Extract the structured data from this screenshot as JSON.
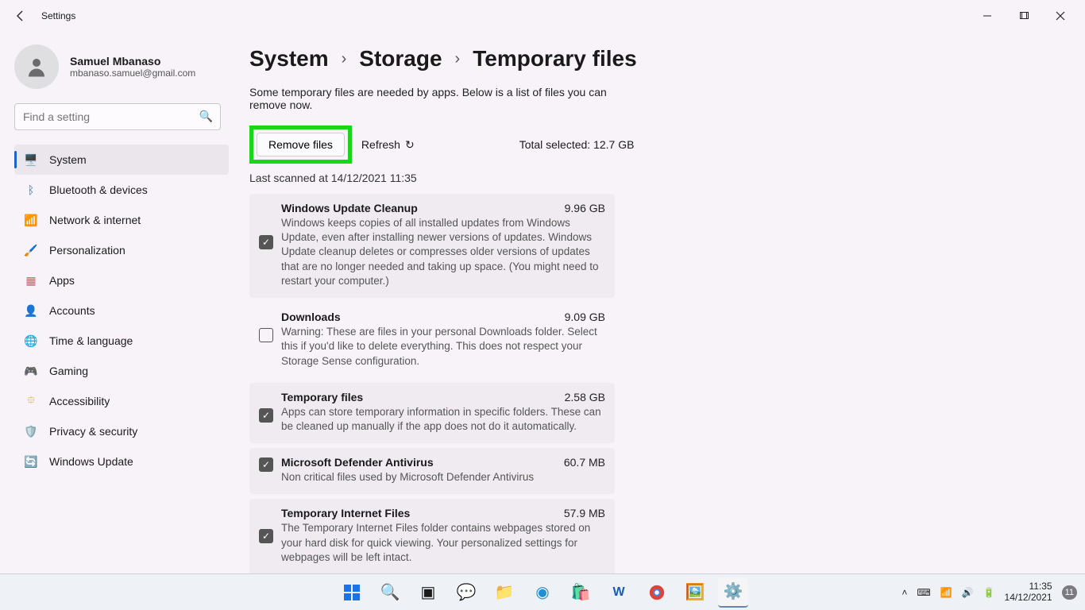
{
  "app": {
    "title": "Settings"
  },
  "user": {
    "name": "Samuel Mbanaso",
    "email": "mbanaso.samuel@gmail.com"
  },
  "search": {
    "placeholder": "Find a setting"
  },
  "nav": [
    {
      "label": "System",
      "icon": "🖥️",
      "active": true
    },
    {
      "label": "Bluetooth & devices",
      "icon": "ᛒ",
      "color": "#1a73e8"
    },
    {
      "label": "Network & internet",
      "icon": "📶",
      "color": "#1a9ae8"
    },
    {
      "label": "Personalization",
      "icon": "🖌️"
    },
    {
      "label": "Apps",
      "icon": "▦",
      "color": "#d85a5a"
    },
    {
      "label": "Accounts",
      "icon": "👤",
      "color": "#2bbf55"
    },
    {
      "label": "Time & language",
      "icon": "🌐",
      "color": "#3b7dd8"
    },
    {
      "label": "Gaming",
      "icon": "🎮",
      "color": "#777"
    },
    {
      "label": "Accessibility",
      "icon": "⯐",
      "color": "#d8a32b"
    },
    {
      "label": "Privacy & security",
      "icon": "🛡️",
      "color": "#777"
    },
    {
      "label": "Windows Update",
      "icon": "🔄",
      "color": "#1a73e8"
    }
  ],
  "breadcrumb": {
    "a": "System",
    "b": "Storage",
    "c": "Temporary files"
  },
  "page": {
    "description": "Some temporary files are needed by apps. Below is a list of files you can remove now.",
    "remove_label": "Remove files",
    "refresh_label": "Refresh",
    "total_label": "Total selected:",
    "total_value": "12.7 GB",
    "last_scanned": "Last scanned at 14/12/2021 11:35"
  },
  "items": [
    {
      "title": "Windows Update Cleanup",
      "size": "9.96 GB",
      "checked": true,
      "desc": "Windows keeps copies of all installed updates from Windows Update, even after installing newer versions of updates. Windows Update cleanup deletes or compresses older versions of updates that are no longer needed and taking up space. (You might need to restart your computer.)"
    },
    {
      "title": "Downloads",
      "size": "9.09 GB",
      "checked": false,
      "desc": "Warning: These are files in your personal Downloads folder. Select this if you'd like to delete everything. This does not respect your Storage Sense configuration."
    },
    {
      "title": "Temporary files",
      "size": "2.58 GB",
      "checked": true,
      "desc": "Apps can store temporary information in specific folders. These can be cleaned up manually if the app does not do it automatically."
    },
    {
      "title": "Microsoft Defender Antivirus",
      "size": "60.7 MB",
      "checked": true,
      "desc": "Non critical files used by Microsoft Defender Antivirus"
    },
    {
      "title": "Temporary Internet Files",
      "size": "57.9 MB",
      "checked": true,
      "desc": "The Temporary Internet Files folder contains webpages stored on your hard disk for quick viewing. Your personalized settings for webpages will be left intact."
    }
  ],
  "taskbar": {
    "time": "11:35",
    "date": "14/12/2021",
    "notifications": "11"
  }
}
